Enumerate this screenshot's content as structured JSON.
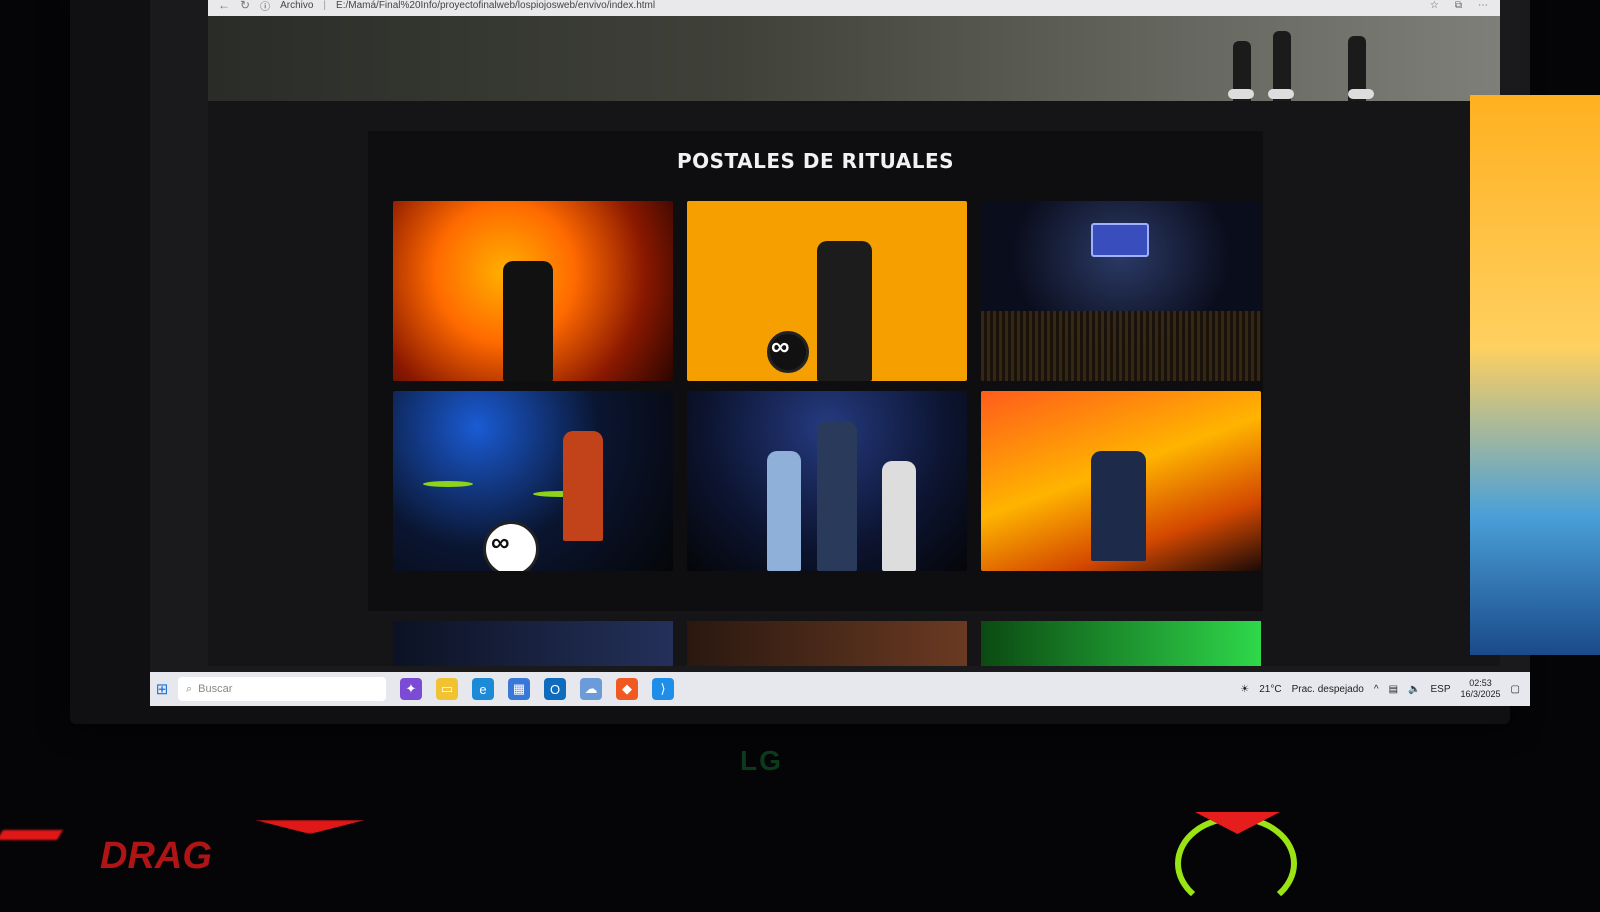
{
  "browser": {
    "back_icon": "back-arrow-icon",
    "reload_icon": "reload-icon",
    "site_info": "Archivo",
    "url": "E:/Mamá/Final%20Info/proyectofinalweb/lospiojosweb/envivo/index.html",
    "favorite_icon": "star-icon",
    "collections_icon": "collections-icon",
    "more_icon": "more-icon"
  },
  "page": {
    "gallery_title": "POSTALES DE RITUALES",
    "photos": [
      {
        "icon": "concert-photo"
      },
      {
        "icon": "concert-photo"
      },
      {
        "icon": "concert-photo"
      },
      {
        "icon": "concert-photo"
      },
      {
        "icon": "concert-photo"
      },
      {
        "icon": "concert-photo"
      }
    ],
    "infinity_symbol": "∞"
  },
  "taskbar": {
    "start_icon": "windows-start-icon",
    "search_placeholder": "Buscar",
    "apps": [
      "copilot-icon",
      "file-explorer-icon",
      "edge-icon",
      "store-icon",
      "outlook-icon",
      "onedrive-icon",
      "brave-icon",
      "vscode-icon"
    ],
    "weather_temp": "21°C",
    "weather_desc": "Prac. despejado",
    "language": "ESP",
    "time": "02:53",
    "date": "16/3/2025"
  },
  "hardware": {
    "monitor_brand": "LG",
    "keyboard_brand_text": "DRAG"
  }
}
